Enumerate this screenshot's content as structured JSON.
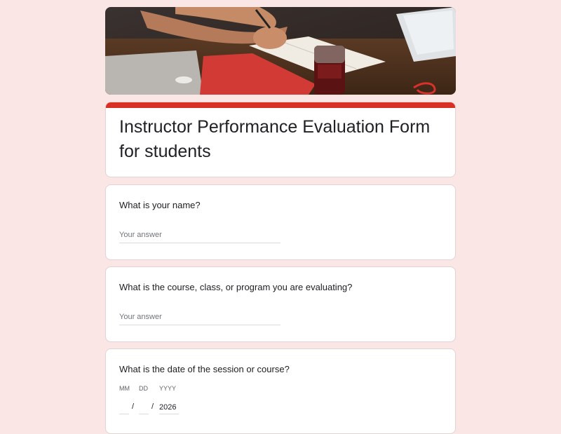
{
  "form": {
    "title": "Instructor Performance Evaluation Form for students"
  },
  "questions": [
    {
      "text": "What is your name?",
      "placeholder": "Your answer"
    },
    {
      "text": "What is the course, class, or program you are evaluating?",
      "placeholder": "Your answer"
    },
    {
      "text": "What is the date of the session or course?"
    }
  ],
  "date": {
    "mm_label": "MM",
    "dd_label": "DD",
    "yyyy_label": "YYYY",
    "separator": "/",
    "month_value": "",
    "day_value": "",
    "year_value": "2026"
  },
  "colors": {
    "background": "#fbe6e6",
    "accent": "#d93025"
  }
}
